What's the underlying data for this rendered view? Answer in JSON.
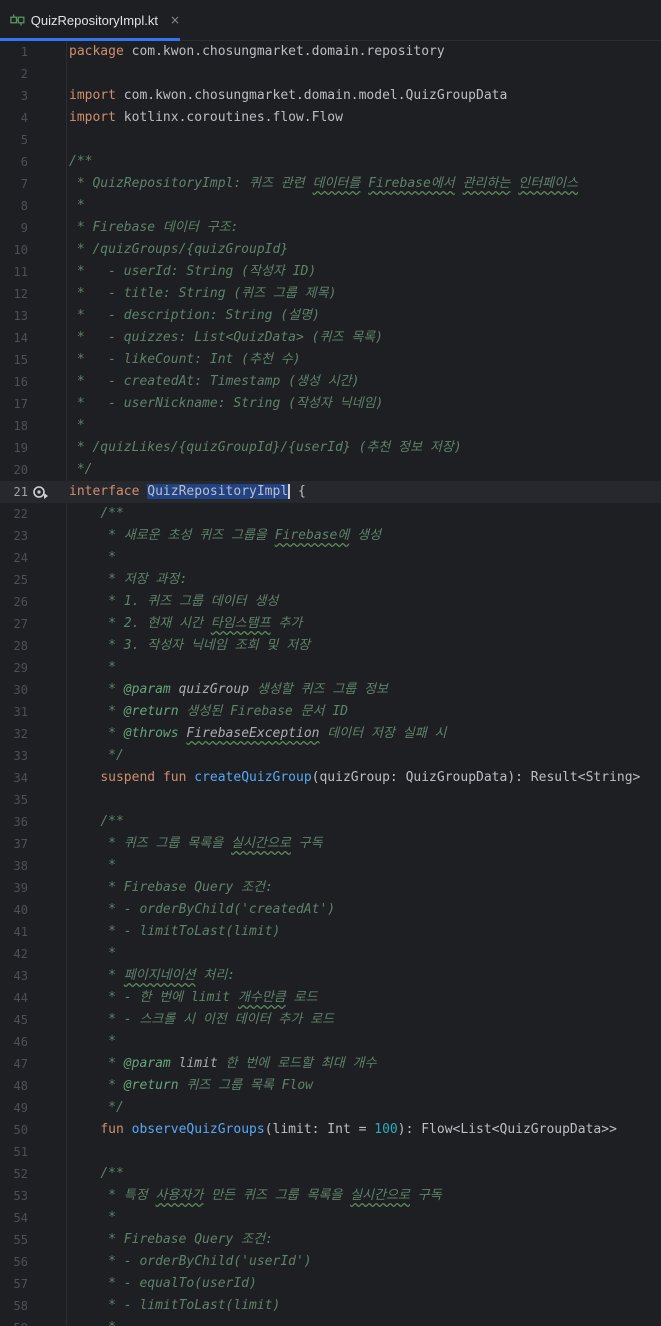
{
  "tab": {
    "label": "QuizRepositoryImpl.kt",
    "close": "×",
    "icon": "kotlin-interface-file-icon"
  },
  "colors": {
    "background": "#1e1f22",
    "keyword": "#cf8e6d",
    "function": "#56a8f5",
    "comment": "#5f826b",
    "number": "#2aacb8",
    "accent": "#3574f0",
    "selection": "#214283"
  },
  "editor": {
    "caret_line": 21,
    "lines": [
      {
        "n": "1",
        "segs": [
          {
            "t": "package",
            "c": "kw"
          },
          {
            "t": " com.kwon.chosungmarket.domain.repository"
          }
        ]
      },
      {
        "n": "2",
        "segs": []
      },
      {
        "n": "3",
        "segs": [
          {
            "t": "import",
            "c": "kw"
          },
          {
            "t": " com.kwon.chosungmarket.domain.model.QuizGroupData"
          }
        ]
      },
      {
        "n": "4",
        "segs": [
          {
            "t": "import",
            "c": "kw"
          },
          {
            "t": " kotlinx.coroutines.flow.Flow"
          }
        ]
      },
      {
        "n": "5",
        "segs": []
      },
      {
        "n": "6",
        "segs": [
          {
            "t": "/**",
            "c": "cm"
          }
        ]
      },
      {
        "n": "7",
        "segs": [
          {
            "t": " * QuizRepositoryImpl: 퀴즈 관련 ",
            "c": "cm"
          },
          {
            "t": "데이터를",
            "c": "cm wavy"
          },
          {
            "t": " ",
            "c": "cm"
          },
          {
            "t": "Firebase에서",
            "c": "cm wavy"
          },
          {
            "t": " ",
            "c": "cm"
          },
          {
            "t": "관리하는",
            "c": "cm wavy"
          },
          {
            "t": " ",
            "c": "cm"
          },
          {
            "t": "인터페이스",
            "c": "cm wavy"
          }
        ]
      },
      {
        "n": "8",
        "segs": [
          {
            "t": " *",
            "c": "cm"
          }
        ]
      },
      {
        "n": "9",
        "segs": [
          {
            "t": " * Firebase 데이터 구조:",
            "c": "cm"
          }
        ]
      },
      {
        "n": "10",
        "segs": [
          {
            "t": " * /quizGroups/{quizGroupId}",
            "c": "cm"
          }
        ]
      },
      {
        "n": "11",
        "segs": [
          {
            "t": " *   - userId: String (작성자 ID)",
            "c": "cm"
          }
        ]
      },
      {
        "n": "12",
        "segs": [
          {
            "t": " *   - title: String (퀴즈 그룹 제목)",
            "c": "cm"
          }
        ]
      },
      {
        "n": "13",
        "segs": [
          {
            "t": " *   - description: String (설명)",
            "c": "cm"
          }
        ]
      },
      {
        "n": "14",
        "segs": [
          {
            "t": " *   - quizzes: List<QuizData> (퀴즈 목록)",
            "c": "cm"
          }
        ]
      },
      {
        "n": "15",
        "segs": [
          {
            "t": " *   - likeCount: Int (추천 수)",
            "c": "cm"
          }
        ]
      },
      {
        "n": "16",
        "segs": [
          {
            "t": " *   - createdAt: Timestamp (생성 시간)",
            "c": "cm"
          }
        ]
      },
      {
        "n": "17",
        "segs": [
          {
            "t": " *   - userNickname: String (작성자 닉네임)",
            "c": "cm"
          }
        ]
      },
      {
        "n": "18",
        "segs": [
          {
            "t": " *",
            "c": "cm"
          }
        ]
      },
      {
        "n": "19",
        "segs": [
          {
            "t": " * /quizLikes/{quizGroupId}/{userId} (추천 정보 저장)",
            "c": "cm"
          }
        ]
      },
      {
        "n": "20",
        "segs": [
          {
            "t": " */",
            "c": "cm"
          }
        ]
      },
      {
        "n": "21",
        "glyph": true,
        "segs": [
          {
            "t": "interface",
            "c": "kw"
          },
          {
            "t": " "
          },
          {
            "t": "QuizRepositoryImpl",
            "c": "sel"
          },
          {
            "t": " {"
          }
        ]
      },
      {
        "n": "22",
        "segs": [
          {
            "t": "    "
          },
          {
            "t": "/**",
            "c": "cm"
          }
        ]
      },
      {
        "n": "23",
        "segs": [
          {
            "t": "     * 새로운 초성 퀴즈 그룹을 ",
            "c": "cm"
          },
          {
            "t": "Firebase에",
            "c": "cm wavy"
          },
          {
            "t": " 생성",
            "c": "cm"
          }
        ]
      },
      {
        "n": "24",
        "segs": [
          {
            "t": "     *",
            "c": "cm"
          }
        ]
      },
      {
        "n": "25",
        "segs": [
          {
            "t": "     * 저장 과정:",
            "c": "cm"
          }
        ]
      },
      {
        "n": "26",
        "segs": [
          {
            "t": "     * 1. 퀴즈 그룹 데이터 생성",
            "c": "cm"
          }
        ]
      },
      {
        "n": "27",
        "segs": [
          {
            "t": "     * 2. 현재 시간 ",
            "c": "cm"
          },
          {
            "t": "타임스탬프",
            "c": "cm wavy"
          },
          {
            "t": " 추가",
            "c": "cm"
          }
        ]
      },
      {
        "n": "28",
        "segs": [
          {
            "t": "     * 3. 작성자 닉네임 조회 및 저장",
            "c": "cm"
          }
        ]
      },
      {
        "n": "29",
        "segs": [
          {
            "t": "     *",
            "c": "cm"
          }
        ]
      },
      {
        "n": "30",
        "segs": [
          {
            "t": "     * ",
            "c": "cm"
          },
          {
            "t": "@param",
            "c": "tag"
          },
          {
            "t": " ",
            "c": "cm"
          },
          {
            "t": "quizGroup",
            "c": "tagv"
          },
          {
            "t": " 생성할 퀴즈 그룹 정보",
            "c": "cm"
          }
        ]
      },
      {
        "n": "31",
        "segs": [
          {
            "t": "     * ",
            "c": "cm"
          },
          {
            "t": "@return",
            "c": "tag"
          },
          {
            "t": " 생성된 Firebase 문서 ID",
            "c": "cm"
          }
        ]
      },
      {
        "n": "32",
        "segs": [
          {
            "t": "     * ",
            "c": "cm"
          },
          {
            "t": "@throws",
            "c": "tag"
          },
          {
            "t": " ",
            "c": "cm"
          },
          {
            "t": "FirebaseException",
            "c": "tagv wavy"
          },
          {
            "t": " 데이터 저장 실패 시",
            "c": "cm"
          }
        ]
      },
      {
        "n": "33",
        "segs": [
          {
            "t": "     */",
            "c": "cm"
          }
        ]
      },
      {
        "n": "34",
        "segs": [
          {
            "t": "    "
          },
          {
            "t": "suspend",
            "c": "kw"
          },
          {
            "t": " "
          },
          {
            "t": "fun",
            "c": "kw"
          },
          {
            "t": " "
          },
          {
            "t": "createQuizGroup",
            "c": "fn"
          },
          {
            "t": "(quizGroup: QuizGroupData): Result<String>"
          }
        ]
      },
      {
        "n": "35",
        "segs": []
      },
      {
        "n": "36",
        "segs": [
          {
            "t": "    "
          },
          {
            "t": "/**",
            "c": "cm"
          }
        ]
      },
      {
        "n": "37",
        "segs": [
          {
            "t": "     * 퀴즈 그룹 목록을 ",
            "c": "cm"
          },
          {
            "t": "실시간으로",
            "c": "cm wavy"
          },
          {
            "t": " 구독",
            "c": "cm"
          }
        ]
      },
      {
        "n": "38",
        "segs": [
          {
            "t": "     *",
            "c": "cm"
          }
        ]
      },
      {
        "n": "39",
        "segs": [
          {
            "t": "     * Firebase Query 조건:",
            "c": "cm"
          }
        ]
      },
      {
        "n": "40",
        "segs": [
          {
            "t": "     * - orderByChild('createdAt')",
            "c": "cm"
          }
        ]
      },
      {
        "n": "41",
        "segs": [
          {
            "t": "     * - limitToLast(limit)",
            "c": "cm"
          }
        ]
      },
      {
        "n": "42",
        "segs": [
          {
            "t": "     *",
            "c": "cm"
          }
        ]
      },
      {
        "n": "43",
        "segs": [
          {
            "t": "     * ",
            "c": "cm"
          },
          {
            "t": "페이지네이션",
            "c": "cm wavy"
          },
          {
            "t": " 처리:",
            "c": "cm"
          }
        ]
      },
      {
        "n": "44",
        "segs": [
          {
            "t": "     * - 한 번에 limit ",
            "c": "cm"
          },
          {
            "t": "개수만큼",
            "c": "cm wavy"
          },
          {
            "t": " 로드",
            "c": "cm"
          }
        ]
      },
      {
        "n": "45",
        "segs": [
          {
            "t": "     * - 스크롤 시 이전 데이터 추가 로드",
            "c": "cm"
          }
        ]
      },
      {
        "n": "46",
        "segs": [
          {
            "t": "     *",
            "c": "cm"
          }
        ]
      },
      {
        "n": "47",
        "segs": [
          {
            "t": "     * ",
            "c": "cm"
          },
          {
            "t": "@param",
            "c": "tag"
          },
          {
            "t": " ",
            "c": "cm"
          },
          {
            "t": "limit",
            "c": "tagv"
          },
          {
            "t": " 한 번에 로드할 최대 개수",
            "c": "cm"
          }
        ]
      },
      {
        "n": "48",
        "segs": [
          {
            "t": "     * ",
            "c": "cm"
          },
          {
            "t": "@return",
            "c": "tag"
          },
          {
            "t": " 퀴즈 그룹 목록 Flow",
            "c": "cm"
          }
        ]
      },
      {
        "n": "49",
        "segs": [
          {
            "t": "     */",
            "c": "cm"
          }
        ]
      },
      {
        "n": "50",
        "segs": [
          {
            "t": "    "
          },
          {
            "t": "fun",
            "c": "kw"
          },
          {
            "t": " "
          },
          {
            "t": "observeQuizGroups",
            "c": "fn"
          },
          {
            "t": "(limit: Int = "
          },
          {
            "t": "100",
            "c": "num"
          },
          {
            "t": "): Flow<List<QuizGroupData>>"
          }
        ]
      },
      {
        "n": "51",
        "segs": []
      },
      {
        "n": "52",
        "segs": [
          {
            "t": "    "
          },
          {
            "t": "/**",
            "c": "cm"
          }
        ]
      },
      {
        "n": "53",
        "segs": [
          {
            "t": "     * 특정 ",
            "c": "cm"
          },
          {
            "t": "사용자가",
            "c": "cm wavy"
          },
          {
            "t": " 만든 퀴즈 그룹 목록을 ",
            "c": "cm"
          },
          {
            "t": "실시간으로",
            "c": "cm wavy"
          },
          {
            "t": " 구독",
            "c": "cm"
          }
        ]
      },
      {
        "n": "54",
        "segs": [
          {
            "t": "     *",
            "c": "cm"
          }
        ]
      },
      {
        "n": "55",
        "segs": [
          {
            "t": "     * Firebase Query 조건:",
            "c": "cm"
          }
        ]
      },
      {
        "n": "56",
        "segs": [
          {
            "t": "     * - orderByChild('userId')",
            "c": "cm"
          }
        ]
      },
      {
        "n": "57",
        "segs": [
          {
            "t": "     * - equalTo(userId)",
            "c": "cm"
          }
        ]
      },
      {
        "n": "58",
        "segs": [
          {
            "t": "     * - limitToLast(limit)",
            "c": "cm"
          }
        ]
      },
      {
        "n": "59",
        "segs": [
          {
            "t": "     *",
            "c": "cm"
          }
        ]
      }
    ]
  }
}
